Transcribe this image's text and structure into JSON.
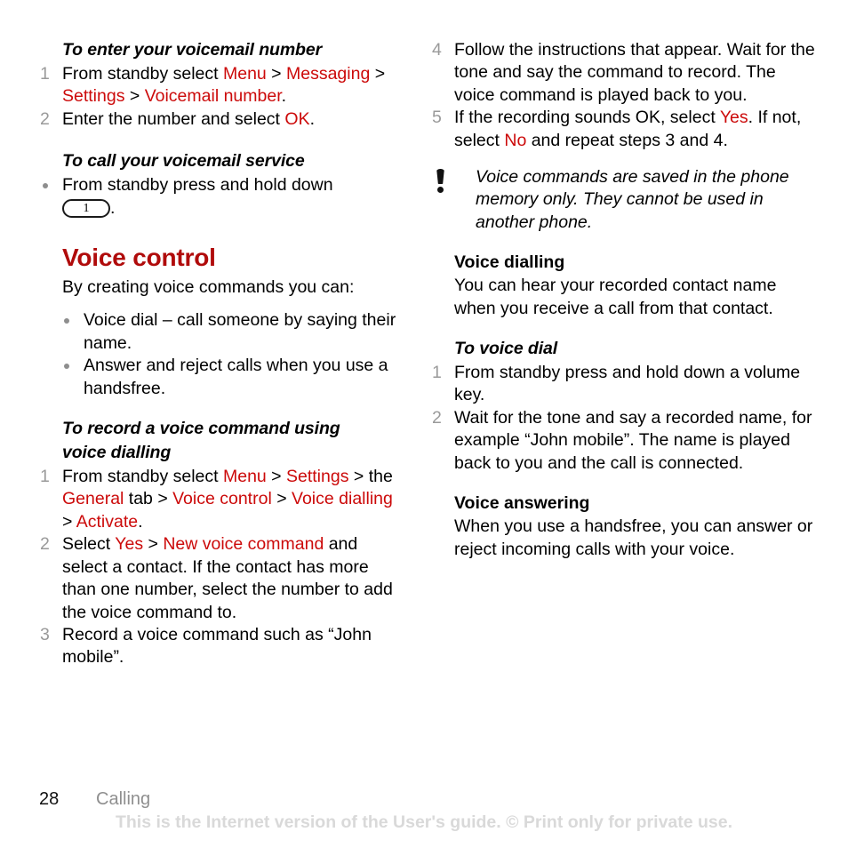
{
  "document": {
    "page_number": "28",
    "chapter": "Calling",
    "watermark": "This is the Internet version of the User's guide. © Print only for private use.",
    "accent_red": "#cc0a0a",
    "heading_red": "#b00b0b",
    "marker_gray": "#9a9a9a"
  },
  "left_column": {
    "task1": {
      "heading": "To enter your voicemail number",
      "steps": [
        {
          "num": "1",
          "parts": [
            {
              "t": "From standby select ",
              "c": "black"
            },
            {
              "t": "Menu",
              "c": "red"
            },
            {
              "t": " > ",
              "c": "black"
            },
            {
              "t": "Messaging",
              "c": "red"
            },
            {
              "t": " > ",
              "c": "black"
            },
            {
              "t": "Settings",
              "c": "red"
            },
            {
              "t": " > ",
              "c": "black"
            },
            {
              "t": "Voicemail number",
              "c": "red"
            },
            {
              "t": ".",
              "c": "black"
            }
          ]
        },
        {
          "num": "2",
          "parts": [
            {
              "t": "Enter the number and select ",
              "c": "black"
            },
            {
              "t": "OK",
              "c": "red"
            },
            {
              "t": ".",
              "c": "black"
            }
          ]
        }
      ]
    },
    "task2": {
      "heading": "To call your voicemail service",
      "bullet_text_before_key": "From standby press and hold down",
      "key_label": "1",
      "bullet_text_after_key": "."
    },
    "section": {
      "heading": "Voice control",
      "intro": "By creating voice commands you can:",
      "bullets": [
        "Voice dial – call someone by saying their name.",
        "Answer and reject calls when you use a handsfree."
      ]
    },
    "task3": {
      "heading_line1": "To record a voice command using",
      "heading_line2": "voice dialling",
      "steps": [
        {
          "num": "1",
          "parts": [
            {
              "t": "From standby select ",
              "c": "black"
            },
            {
              "t": "Menu",
              "c": "red"
            },
            {
              "t": " > ",
              "c": "black"
            },
            {
              "t": "Settings",
              "c": "red"
            },
            {
              "t": " > the ",
              "c": "black"
            },
            {
              "t": "General",
              "c": "red"
            },
            {
              "t": " tab > ",
              "c": "black"
            },
            {
              "t": "Voice control",
              "c": "red"
            },
            {
              "t": " > ",
              "c": "black"
            },
            {
              "t": "Voice dialling",
              "c": "red"
            },
            {
              "t": " > ",
              "c": "black"
            },
            {
              "t": "Activate",
              "c": "red"
            },
            {
              "t": ".",
              "c": "black"
            }
          ]
        },
        {
          "num": "2",
          "parts": [
            {
              "t": "Select ",
              "c": "black"
            },
            {
              "t": "Yes",
              "c": "red"
            },
            {
              "t": " > ",
              "c": "black"
            },
            {
              "t": "New voice command",
              "c": "red"
            },
            {
              "t": " and select a contact. If the contact has more than one number, select the number to add the voice command to.",
              "c": "black"
            }
          ]
        },
        {
          "num": "3",
          "parts": [
            {
              "t": "Record a voice command such as “John mobile”.",
              "c": "black"
            }
          ]
        }
      ]
    }
  },
  "right_column": {
    "steps_continued": [
      {
        "num": "4",
        "parts": [
          {
            "t": "Follow the instructions that appear. Wait for the tone and say the command to record. The voice command is played back to you.",
            "c": "black"
          }
        ]
      },
      {
        "num": "5",
        "parts": [
          {
            "t": "If the recording sounds OK, select ",
            "c": "black"
          },
          {
            "t": "Yes",
            "c": "red"
          },
          {
            "t": ". If not, select ",
            "c": "black"
          },
          {
            "t": "No",
            "c": "red"
          },
          {
            "t": " and repeat steps 3 and 4.",
            "c": "black"
          }
        ]
      }
    ],
    "note": {
      "icon": "exclamation-icon",
      "text": "Voice commands are saved in the phone memory only. They cannot be used in another phone."
    },
    "voice_dialling": {
      "heading": "Voice dialling",
      "body": "You can hear your recorded contact name when you receive a call from that contact."
    },
    "task_voice_dial": {
      "heading": "To voice dial",
      "steps": [
        {
          "num": "1",
          "parts": [
            {
              "t": "From standby press and hold down a volume key.",
              "c": "black"
            }
          ]
        },
        {
          "num": "2",
          "parts": [
            {
              "t": "Wait for the tone and say a recorded name, for example “John mobile”. The name is played back to you and the call is connected.",
              "c": "black"
            }
          ]
        }
      ]
    },
    "voice_answering": {
      "heading": "Voice answering",
      "body": "When you use a handsfree, you can answer or reject incoming calls with your voice."
    }
  }
}
